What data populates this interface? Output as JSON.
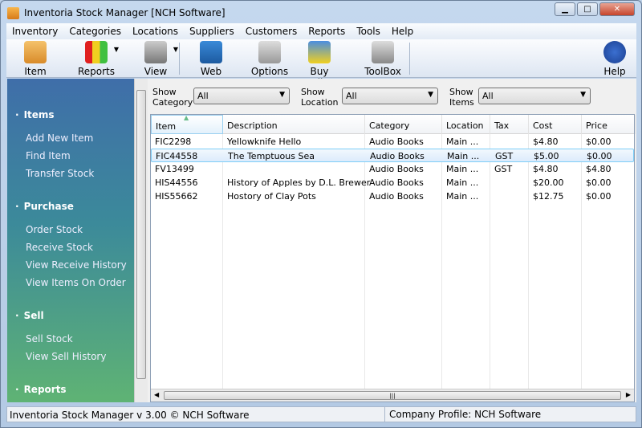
{
  "window": {
    "title": "Inventoria Stock Manager [NCH Software]",
    "minimize": "▁",
    "maximize": "□",
    "close": "✕"
  },
  "menu": [
    "Inventory",
    "Categories",
    "Locations",
    "Suppliers",
    "Customers",
    "Reports",
    "Tools",
    "Help"
  ],
  "toolbar": [
    {
      "label": "Item",
      "icon": "add-item-icon"
    },
    {
      "label": "Reports",
      "icon": "bar-chart-icon"
    },
    {
      "label": "View",
      "icon": "binoculars-icon"
    },
    {
      "label": "Web Access",
      "icon": "globe-window-icon"
    },
    {
      "label": "Options",
      "icon": "tools-icon"
    },
    {
      "label": "Buy Online",
      "icon": "globe-key-icon"
    },
    {
      "label": "ToolBox",
      "icon": "toolbox-icon"
    },
    {
      "label": "Help",
      "icon": "help-icon"
    }
  ],
  "sidebar": {
    "sections": [
      {
        "title": "Items",
        "items": [
          "Add New Item",
          "Find Item",
          "Transfer Stock"
        ]
      },
      {
        "title": "Purchase",
        "items": [
          "Order Stock",
          "Receive Stock",
          "View Receive History",
          "View Items On Order"
        ]
      },
      {
        "title": "Sell",
        "items": [
          "Sell Stock",
          "View Sell History"
        ]
      },
      {
        "title": "Reports",
        "items": []
      }
    ]
  },
  "filters": [
    {
      "label1": "Show",
      "label2": "Category",
      "value": "All"
    },
    {
      "label1": "Show",
      "label2": "Location",
      "value": "All"
    },
    {
      "label1": "Show",
      "label2": "Items",
      "value": "All"
    }
  ],
  "table": {
    "columns": [
      "Item",
      "Description",
      "Category",
      "Location",
      "Tax",
      "Cost",
      "Price"
    ],
    "rows": [
      [
        "FIC2298",
        "Yellowknife Hello",
        "Audio Books",
        "Main ...",
        "",
        "$4.80",
        "$0.00"
      ],
      [
        "FIC44558",
        "The Temptuous Sea",
        "Audio Books",
        "Main ...",
        "GST",
        "$5.00",
        "$0.00"
      ],
      [
        "FV13499",
        "",
        "Audio Books",
        "Main ...",
        "GST",
        "$4.80",
        "$4.80"
      ],
      [
        "HIS44556",
        "History of Apples by D.L. Brewer",
        "Audio Books",
        "Main ...",
        "",
        "$20.00",
        "$0.00"
      ],
      [
        "HIS55662",
        "Hostory of Clay Pots",
        "Audio Books",
        "Main ...",
        "",
        "$12.75",
        "$0.00"
      ]
    ],
    "selected_row": 1,
    "sort_column": "Item"
  },
  "status": {
    "left": "Inventoria Stock Manager v 3.00 © NCH Software",
    "right": "Company Profile: NCH Software"
  }
}
